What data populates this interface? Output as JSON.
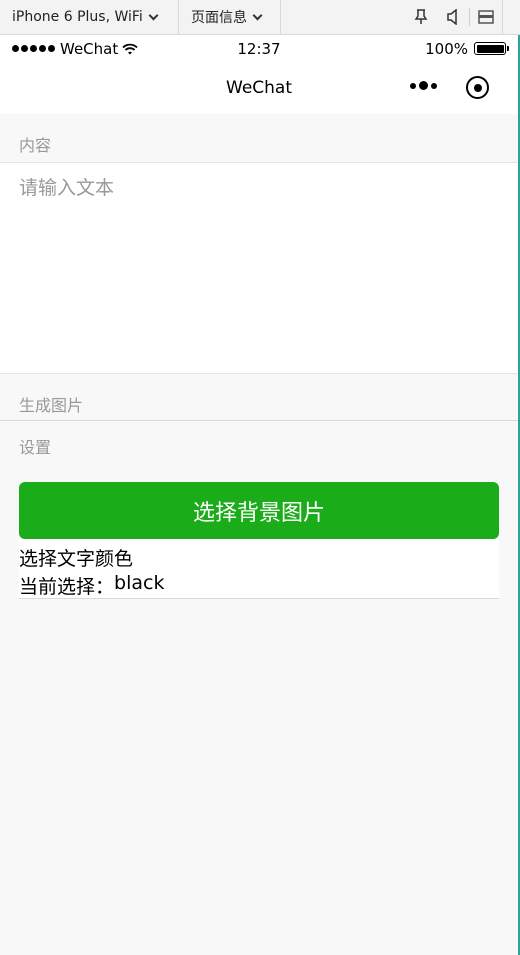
{
  "devtools": {
    "device_label": "iPhone 6 Plus, WiFi",
    "page_info_label": "页面信息",
    "icons": [
      "pin-icon",
      "speaker-icon",
      "window-icon"
    ]
  },
  "status_bar": {
    "carrier": "WeChat",
    "time": "12:37",
    "battery": "100%"
  },
  "nav_bar": {
    "title": "WeChat"
  },
  "content": {
    "section_label": "内容",
    "input_placeholder": "请输入文本",
    "input_value": ""
  },
  "generate": {
    "label": "生成图片"
  },
  "settings": {
    "label": "设置",
    "bg_button_label": "选择背景图片",
    "text_color_label": "选择文字颜色",
    "current_prefix": "当前选择：",
    "current_value": "black"
  },
  "colors": {
    "primary": "#1aad19",
    "page_bg": "#f8f8f8",
    "muted_text": "#999999"
  }
}
